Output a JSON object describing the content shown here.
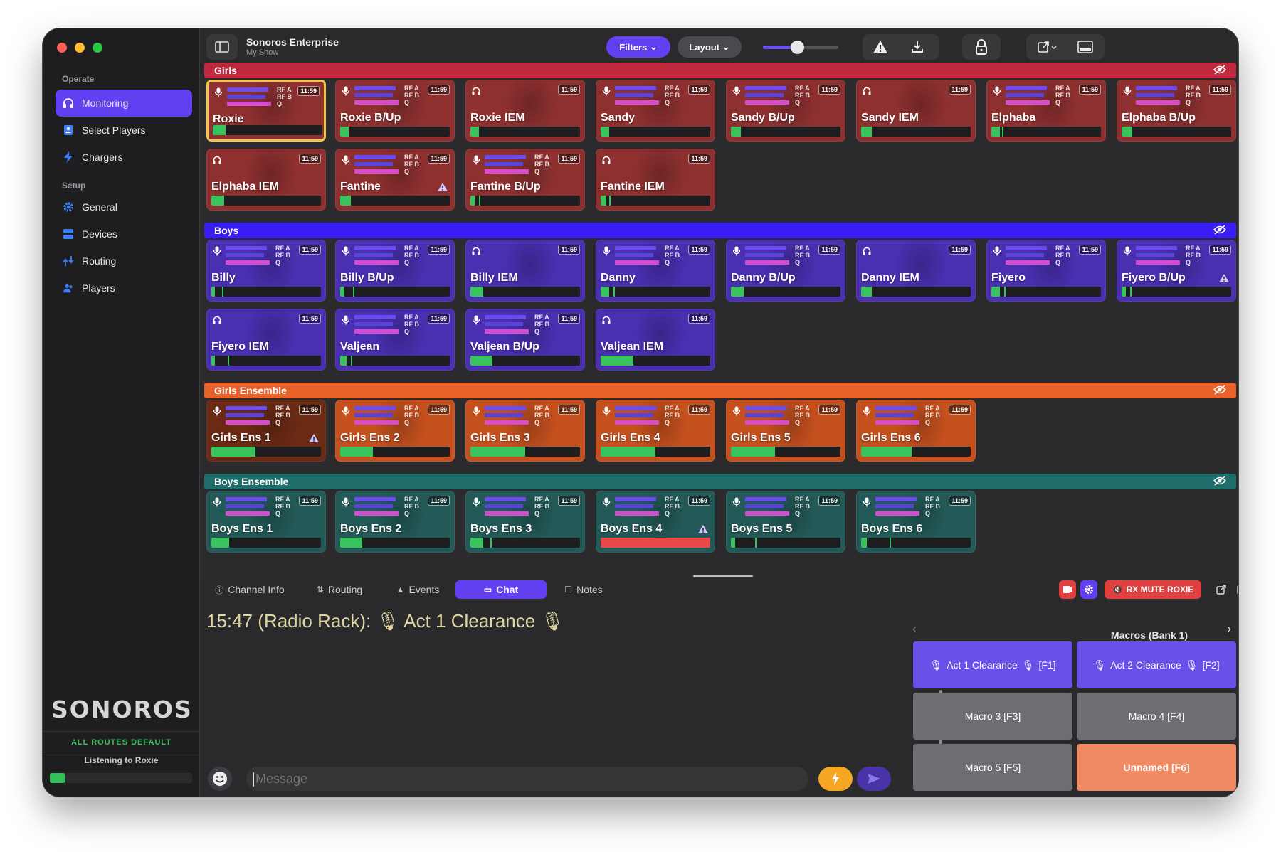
{
  "app": {
    "title": "Sonoros Enterprise",
    "subtitle": "My Show"
  },
  "toolbar": {
    "filters": "Filters",
    "layout": "Layout",
    "volume": 0.45
  },
  "sidebar": {
    "operate_label": "Operate",
    "setup_label": "Setup",
    "items": [
      {
        "label": "Monitoring",
        "icon": "headphones-icon",
        "active": true
      },
      {
        "label": "Select Players",
        "icon": "id-card-icon"
      },
      {
        "label": "Chargers",
        "icon": "bolt-icon"
      },
      {
        "label": "General",
        "icon": "gear-icon"
      },
      {
        "label": "Devices",
        "icon": "server-icon"
      },
      {
        "label": "Routing",
        "icon": "routing-icon"
      },
      {
        "label": "Players",
        "icon": "users-icon"
      }
    ],
    "logo": "SONOROS",
    "routes": "ALL ROUTES DEFAULT",
    "listening": "Listening to Roxie"
  },
  "rf": {
    "a": "RF A",
    "b": "RF B",
    "q": "Q",
    "time": "11:59"
  },
  "groups": [
    {
      "name": "Girls",
      "color": "#c0283e",
      "tile": "#8e3030",
      "rows": [
        [
          {
            "n": "Roxie",
            "t": "mic",
            "sel": true,
            "lv": 0.12
          },
          {
            "n": "Roxie B/Up",
            "t": "mic",
            "lv": 0.08
          },
          {
            "n": "Roxie IEM",
            "t": "iem",
            "lv": 0.08
          },
          {
            "n": "Sandy",
            "t": "mic",
            "lv": 0.08
          },
          {
            "n": "Sandy B/Up",
            "t": "mic",
            "lv": 0.09
          },
          {
            "n": "Sandy IEM",
            "t": "iem",
            "lv": 0.1
          },
          {
            "n": "Elphaba",
            "t": "mic",
            "lv": 0.08,
            "pk": 0.1
          },
          {
            "n": "Elphaba B/Up",
            "t": "mic",
            "lv": 0.1
          }
        ],
        [
          {
            "n": "Elphaba IEM",
            "t": "iem",
            "lv": 0.12
          },
          {
            "n": "Fantine",
            "t": "mic",
            "lv": 0.1,
            "warn": true
          },
          {
            "n": "Fantine B/Up",
            "t": "mic",
            "lv": 0.04,
            "pk": 0.08
          },
          {
            "n": "Fantine IEM",
            "t": "iem",
            "lv": 0.05,
            "pk": 0.08
          }
        ]
      ]
    },
    {
      "name": "Boys",
      "color": "#3a1df2",
      "tile": "#4a2fb0",
      "rows": [
        [
          {
            "n": "Billy",
            "t": "mic",
            "lv": 0.03,
            "pk": 0.1
          },
          {
            "n": "Billy B/Up",
            "t": "mic",
            "lv": 0.04,
            "pk": 0.12
          },
          {
            "n": "Billy IEM",
            "t": "iem",
            "lv": 0.12
          },
          {
            "n": "Danny",
            "t": "mic",
            "lv": 0.08,
            "pk": 0.12
          },
          {
            "n": "Danny B/Up",
            "t": "mic",
            "lv": 0.12
          },
          {
            "n": "Danny IEM",
            "t": "iem",
            "lv": 0.1
          },
          {
            "n": "Fiyero",
            "t": "mic",
            "lv": 0.08,
            "pk": 0.12
          },
          {
            "n": "Fiyero B/Up",
            "t": "mic",
            "lv": 0.04,
            "pk": 0.08,
            "warn": true
          }
        ],
        [
          {
            "n": "Fiyero IEM",
            "t": "iem",
            "lv": 0.03,
            "pk": 0.15
          },
          {
            "n": "Valjean",
            "t": "mic",
            "lv": 0.06,
            "pk": 0.1
          },
          {
            "n": "Valjean B/Up",
            "t": "mic",
            "lv": 0.2
          },
          {
            "n": "Valjean IEM",
            "t": "iem",
            "lv": 0.3
          }
        ]
      ]
    },
    {
      "name": "Girls Ensemble",
      "color": "#e8622a",
      "tile": "#c4501e",
      "rows": [
        [
          {
            "n": "Girls Ens 1",
            "t": "mic",
            "lv": 0.4,
            "warn": true,
            "dark": true
          },
          {
            "n": "Girls Ens 2",
            "t": "mic",
            "lv": 0.3
          },
          {
            "n": "Girls Ens 3",
            "t": "mic",
            "lv": 0.5
          },
          {
            "n": "Girls Ens 4",
            "t": "mic",
            "lv": 0.5
          },
          {
            "n": "Girls Ens 5",
            "t": "mic",
            "lv": 0.4
          },
          {
            "n": "Girls Ens 6",
            "t": "mic",
            "lv": 0.46
          }
        ]
      ]
    },
    {
      "name": "Boys Ensemble",
      "color": "#1f6e6c",
      "tile": "#235a58",
      "rows": [
        [
          {
            "n": "Boys Ens 1",
            "t": "mic",
            "lv": 0.16
          },
          {
            "n": "Boys Ens 2",
            "t": "mic",
            "lv": 0.2
          },
          {
            "n": "Boys Ens 3",
            "t": "mic",
            "lv": 0.12,
            "pk": 0.18
          },
          {
            "n": "Boys Ens 4",
            "t": "mic",
            "lv": 1.0,
            "red": true,
            "warn": true
          },
          {
            "n": "Boys Ens 5",
            "t": "mic",
            "lv": 0.04,
            "pk": 0.22
          },
          {
            "n": "Boys Ens 6",
            "t": "mic",
            "lv": 0.05,
            "pk": 0.26
          }
        ]
      ]
    }
  ],
  "bottom": {
    "tabs": [
      {
        "label": "Channel Info",
        "icon": "info-icon"
      },
      {
        "label": "Routing",
        "icon": "routing-icon"
      },
      {
        "label": "Events",
        "icon": "warning-icon"
      },
      {
        "label": "Chat",
        "icon": "chat-icon",
        "active": true
      },
      {
        "label": "Notes",
        "icon": "notes-icon"
      }
    ],
    "rx_mute": "RX MUTE ROXIE",
    "chat_line": "15:47 (Radio Rack): 🎙 Act 1 Clearance 🎙",
    "message_placeholder": "Message",
    "macros_title": "Macros (Bank 1)",
    "macros": [
      {
        "label": "Act 1 Clearance",
        "key": "[F1]",
        "mic": true,
        "color": "#6a4fe8"
      },
      {
        "label": "Act 2 Clearance",
        "key": "[F2]",
        "mic": true,
        "color": "#6a4fe8"
      },
      {
        "label": "Macro 3 [F3]",
        "color": "#6e6e72"
      },
      {
        "label": "Macro 4 [F4]",
        "color": "#6e6e72"
      },
      {
        "label": "Macro 5 [F5]",
        "color": "#6e6e72"
      },
      {
        "label": "Unnamed [F6]",
        "color": "#f08a62",
        "bold": true
      }
    ]
  }
}
